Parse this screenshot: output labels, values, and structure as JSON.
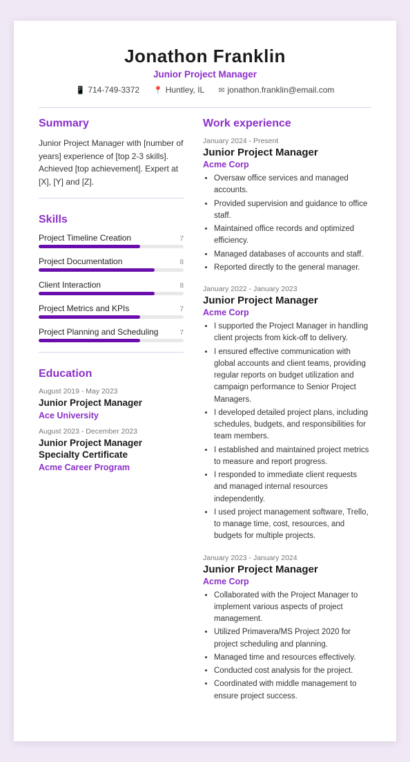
{
  "header": {
    "name": "Jonathon Franklin",
    "title": "Junior Project Manager",
    "contact": {
      "phone": "714-749-3372",
      "location": "Huntley, IL",
      "email": "jonathon.franklin@email.com"
    }
  },
  "summary": {
    "label": "Summary",
    "text": "Junior Project Manager with [number of years] experience of [top 2-3 skills]. Achieved [top achievement]. Expert at [X], [Y] and [Z]."
  },
  "skills": {
    "label": "Skills",
    "items": [
      {
        "name": "Project Timeline Creation",
        "score": 7,
        "percent": 70
      },
      {
        "name": "Project Documentation",
        "score": 8,
        "percent": 80
      },
      {
        "name": "Client Interaction",
        "score": 8,
        "percent": 80
      },
      {
        "name": "Project Metrics and KPIs",
        "score": 7,
        "percent": 70
      },
      {
        "name": "Project Planning and Scheduling",
        "score": 7,
        "percent": 70
      }
    ]
  },
  "education": {
    "label": "Education",
    "items": [
      {
        "date": "August 2019 - May 2023",
        "degree": "Junior Project Manager",
        "school": "Ace University"
      },
      {
        "date": "August 2023 - December 2023",
        "degree": "Junior Project Manager Specialty Certificate",
        "school": "Acme Career Program"
      }
    ]
  },
  "work": {
    "label": "Work experience",
    "items": [
      {
        "date": "January 2024 - Present",
        "title": "Junior Project Manager",
        "company": "Acme Corp",
        "bullets": [
          "Oversaw office services and managed accounts.",
          "Provided supervision and guidance to office staff.",
          "Maintained office records and optimized efficiency.",
          "Managed databases of accounts and staff.",
          "Reported directly to the general manager."
        ]
      },
      {
        "date": "January 2022 - January 2023",
        "title": "Junior Project Manager",
        "company": "Acme Corp",
        "bullets": [
          "I supported the Project Manager in handling client projects from kick-off to delivery.",
          "I ensured effective communication with global accounts and client teams, providing regular reports on budget utilization and campaign performance to Senior Project Managers.",
          "I developed detailed project plans, including schedules, budgets, and responsibilities for team members.",
          "I established and maintained project metrics to measure and report progress.",
          "I responded to immediate client requests and managed internal resources independently.",
          "I used project management software, Trello, to manage time, cost, resources, and budgets for multiple projects."
        ]
      },
      {
        "date": "January 2023 - January 2024",
        "title": "Junior Project Manager",
        "company": "Acme Corp",
        "bullets": [
          "Collaborated with the Project Manager to implement various aspects of project management.",
          "Utilized Primavera/MS Project 2020 for project scheduling and planning.",
          "Managed time and resources effectively.",
          "Conducted cost analysis for the project.",
          "Coordinated with middle management to ensure project success."
        ]
      }
    ]
  },
  "icons": {
    "phone": "📱",
    "location": "📍",
    "email": "✉"
  }
}
